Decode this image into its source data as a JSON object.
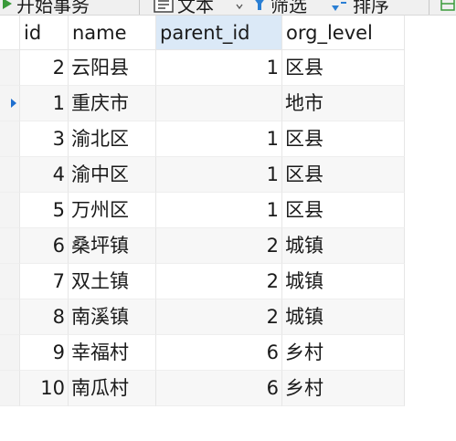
{
  "toolbar": {
    "begin_transaction_label": "开始事务",
    "text_label": "文本",
    "filter_label": "筛选",
    "sort_label": "排序"
  },
  "grid": {
    "columns": [
      {
        "label": "id"
      },
      {
        "label": "name"
      },
      {
        "label": "parent_id"
      },
      {
        "label": "org_level"
      }
    ],
    "rows": [
      {
        "id": "2",
        "name": "云阳县",
        "parent_id": "1",
        "org_level": "区县"
      },
      {
        "id": "1",
        "name": "重庆市",
        "parent_id": "",
        "org_level": "地市"
      },
      {
        "id": "3",
        "name": "渝北区",
        "parent_id": "1",
        "org_level": "区县"
      },
      {
        "id": "4",
        "name": "渝中区",
        "parent_id": "1",
        "org_level": "区县"
      },
      {
        "id": "5",
        "name": "万州区",
        "parent_id": "1",
        "org_level": "区县"
      },
      {
        "id": "6",
        "name": "桑坪镇",
        "parent_id": "2",
        "org_level": "城镇"
      },
      {
        "id": "7",
        "name": "双土镇",
        "parent_id": "2",
        "org_level": "城镇"
      },
      {
        "id": "8",
        "name": "南溪镇",
        "parent_id": "2",
        "org_level": "城镇"
      },
      {
        "id": "9",
        "name": "幸福村",
        "parent_id": "6",
        "org_level": "乡村"
      },
      {
        "id": "10",
        "name": "南瓜村",
        "parent_id": "6",
        "org_level": "乡村"
      }
    ]
  },
  "colors": {
    "selected_header_bg": "#dbe9f7",
    "current_row_arrow": "#1f6fcf",
    "alt_row_bg": "#f7f7f7",
    "toolbar_icon_green": "#3a9a3a",
    "toolbar_icon_blue": "#2a7fd4"
  },
  "icons": {
    "begin_transaction": "play-icon",
    "text": "text-document-icon",
    "filter": "filter-funnel-icon",
    "sort": "sort-arrows-icon",
    "next": "grid-icon"
  }
}
